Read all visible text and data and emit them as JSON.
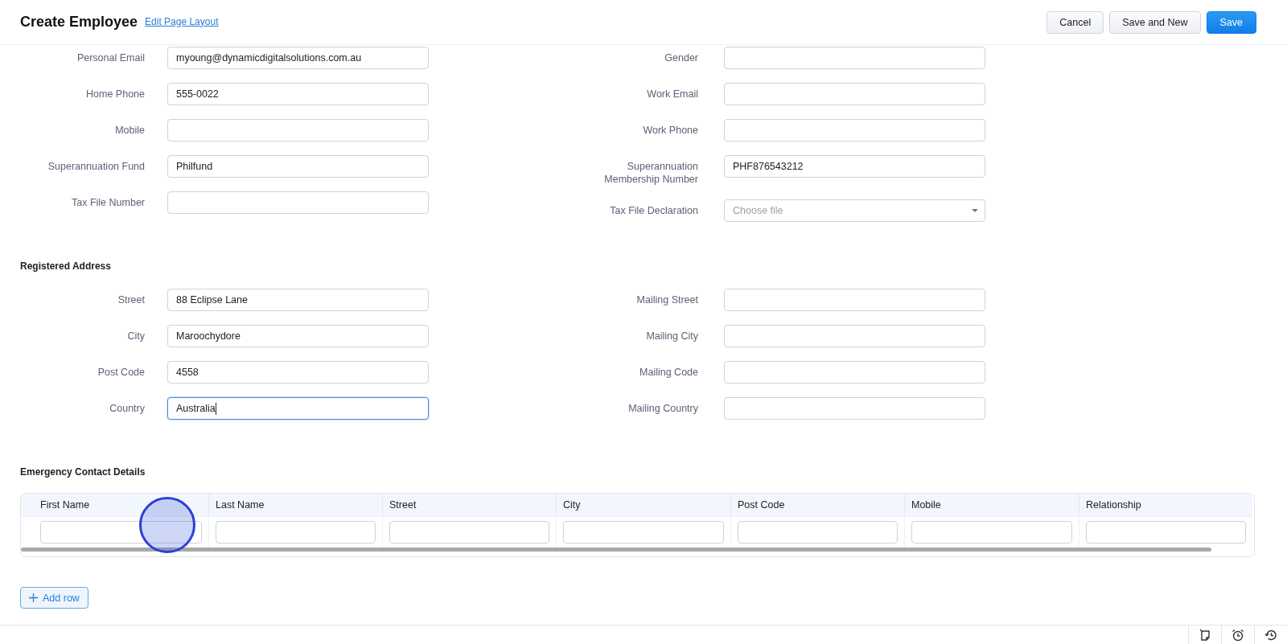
{
  "header": {
    "title": "Create Employee",
    "edit_link": "Edit Page Layout",
    "buttons": [
      {
        "label": "Cancel",
        "kind": "secondary"
      },
      {
        "label": "Save and New",
        "kind": "secondary"
      },
      {
        "label": "Save",
        "kind": "primary"
      }
    ]
  },
  "sections": [
    {
      "left": [
        {
          "label": "Personal Email",
          "value": "myoung@dynamicdigitalsolutions.com.au",
          "kind": "text",
          "focused": false
        },
        {
          "label": "Home Phone",
          "value": "555-0022",
          "kind": "text",
          "focused": false
        },
        {
          "label": "Mobile",
          "kind": "text",
          "focused": false
        },
        {
          "label": "Superannuation Fund",
          "value": "Philfund",
          "kind": "text",
          "focused": false
        },
        {
          "label": "Tax File Number",
          "kind": "text",
          "focused": false
        }
      ],
      "right": [
        {
          "label": "Gender",
          "kind": "text",
          "focused": false
        },
        {
          "label": "Work Email",
          "kind": "text",
          "focused": false
        },
        {
          "label": "Work Phone",
          "kind": "text",
          "focused": false
        },
        {
          "label": "Superannuation Membership Number",
          "value": "PHF876543212",
          "kind": "text",
          "focused": false
        },
        {
          "label": "Tax File Declaration",
          "placeholder": "Choose file",
          "kind": "select",
          "focused": false
        }
      ]
    },
    {
      "heading": "Registered Address",
      "left": [
        {
          "label": "Street",
          "value": "88 Eclipse Lane",
          "kind": "text",
          "focused": false
        },
        {
          "label": "City",
          "value": "Maroochydore",
          "kind": "text",
          "focused": false
        },
        {
          "label": "Post Code",
          "value": "4558",
          "kind": "text",
          "focused": false
        },
        {
          "label": "Country",
          "value": "Australia",
          "kind": "text",
          "focused": true
        }
      ],
      "right": [
        {
          "label": "Mailing Street",
          "kind": "text",
          "focused": false
        },
        {
          "label": "Mailing City",
          "kind": "text",
          "focused": false
        },
        {
          "label": "Mailing Code",
          "kind": "text",
          "focused": false
        },
        {
          "label": "Mailing Country",
          "kind": "text",
          "focused": false
        }
      ]
    }
  ],
  "emergency": {
    "heading": "Emergency Contact Details",
    "columns": [
      "First Name",
      "Last Name",
      "Street",
      "City",
      "Post Code",
      "Mobile",
      "Relationship"
    ],
    "add_row": "Add row"
  }
}
